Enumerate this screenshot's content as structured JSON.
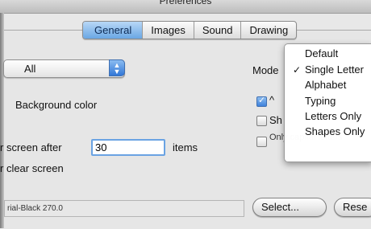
{
  "window": {
    "title": "Preferences"
  },
  "tabs": [
    "General",
    "Images",
    "Sound",
    "Drawing"
  ],
  "popup": {
    "value": "All"
  },
  "labels": {
    "background_color": "Background color",
    "clear_after_prefix": "r screen after",
    "items": "items",
    "clear_screen": "r clear screen",
    "mode": "Mode"
  },
  "clear_after": {
    "value": "30"
  },
  "checkboxes": [
    {
      "label": "^",
      "checked": true
    },
    {
      "label": "Sh",
      "checked": false
    },
    {
      "label": "Only capital letters",
      "checked": false
    }
  ],
  "font": {
    "value": "rial-Black 270.0"
  },
  "buttons": {
    "select": "Select...",
    "reset": "Rese"
  },
  "mode_menu": {
    "items": [
      "Default",
      "Single Letter",
      "Alphabet",
      "Typing",
      "Letters Only",
      "Shapes Only"
    ],
    "checked": "Single Letter"
  },
  "colors": {
    "accent": "#6aa7e4"
  }
}
